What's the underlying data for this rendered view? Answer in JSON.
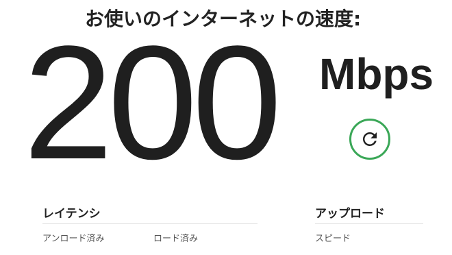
{
  "heading": "お使いのインターネットの速度:",
  "speed": {
    "value": "200",
    "unit": "Mbps"
  },
  "refresh": {
    "icon": "refresh-icon",
    "color": "#3aa757"
  },
  "latency": {
    "title": "レイテンシ",
    "unloaded_label": "アンロード済み",
    "loaded_label": "ロード済み"
  },
  "upload": {
    "title": "アップロード",
    "speed_label": "スピード"
  }
}
